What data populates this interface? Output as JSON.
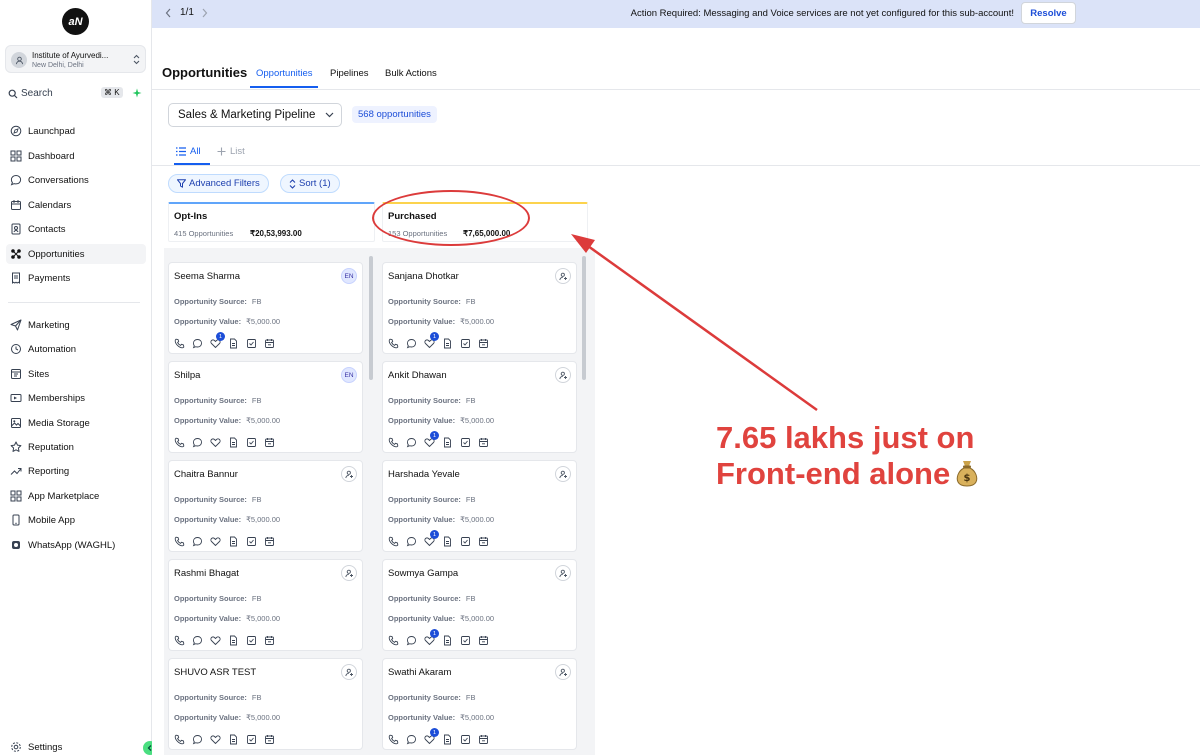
{
  "sidebar": {
    "logo": "aN",
    "account": {
      "name": "Institute of Ayurvedi...",
      "location": "New Delhi, Delhi"
    },
    "search": {
      "label": "Search",
      "shortcut": "⌘ K"
    },
    "items": [
      {
        "label": "Launchpad",
        "icon": "rocket-icon"
      },
      {
        "label": "Dashboard",
        "icon": "grid-icon"
      },
      {
        "label": "Conversations",
        "icon": "chat-icon"
      },
      {
        "label": "Calendars",
        "icon": "calendar-icon"
      },
      {
        "label": "Contacts",
        "icon": "contacts-icon"
      },
      {
        "label": "Opportunities",
        "icon": "opportunities-icon",
        "active": true
      },
      {
        "label": "Payments",
        "icon": "receipt-icon"
      },
      {
        "label": "Marketing",
        "icon": "send-icon"
      },
      {
        "label": "Automation",
        "icon": "automation-icon"
      },
      {
        "label": "Sites",
        "icon": "sites-icon"
      },
      {
        "label": "Memberships",
        "icon": "memberships-icon"
      },
      {
        "label": "Media Storage",
        "icon": "image-icon"
      },
      {
        "label": "Reputation",
        "icon": "star-icon"
      },
      {
        "label": "Reporting",
        "icon": "trend-icon"
      },
      {
        "label": "App Marketplace",
        "icon": "apps-icon"
      },
      {
        "label": "Mobile App",
        "icon": "phone-icon"
      },
      {
        "label": "WhatsApp (WAGHL)",
        "icon": "whatsapp-icon"
      }
    ],
    "settings": "Settings"
  },
  "banner": {
    "pager": "1/1",
    "message": "Action Required: Messaging and Voice services are not yet configured for this sub-account!",
    "resolve": "Resolve"
  },
  "header": {
    "title": "Opportunities",
    "tabs": [
      "Opportunities",
      "Pipelines",
      "Bulk Actions"
    ]
  },
  "toolbar": {
    "pipeline": "Sales & Marketing Pipeline",
    "count": "568 opportunities",
    "view_all": "All",
    "view_list": "List",
    "advanced_filters": "Advanced Filters",
    "sort": "Sort (1)"
  },
  "colors": {
    "accent": "#155eef",
    "banner": "#dbe3f8",
    "annotation": "#e0433e",
    "optins_bar": "#60a5fa",
    "purchased_bar": "#fcd34d"
  },
  "columns": [
    {
      "title": "Opt-Ins",
      "count": "415 Opportunities",
      "total": "₹20,53,993.00",
      "cards": [
        {
          "name": "Seema Sharma",
          "avatar": "EN",
          "source": "FB",
          "value": "₹5,000.00",
          "badge": "1"
        },
        {
          "name": "Shilpa",
          "avatar": "EN",
          "source": "FB",
          "value": "₹5,000.00",
          "badge": ""
        },
        {
          "name": "Chaitra Bannur",
          "avatar": "",
          "source": "FB",
          "value": "₹5,000.00",
          "badge": ""
        },
        {
          "name": "Rashmi Bhagat",
          "avatar": "",
          "source": "FB",
          "value": "₹5,000.00",
          "badge": ""
        },
        {
          "name": "SHUVO ASR TEST",
          "avatar": "",
          "source": "FB",
          "value": "₹5,000.00",
          "badge": ""
        }
      ]
    },
    {
      "title": "Purchased",
      "count": "153 Opportunities",
      "total": "₹7,65,000.00",
      "cards": [
        {
          "name": "Sanjana Dhotkar",
          "avatar": "",
          "source": "FB",
          "value": "₹5,000.00",
          "badge": "1"
        },
        {
          "name": "Ankit Dhawan",
          "avatar": "",
          "source": "FB",
          "value": "₹5,000.00",
          "badge": "1"
        },
        {
          "name": "Harshada Yevale",
          "avatar": "",
          "source": "FB",
          "value": "₹5,000.00",
          "badge": "1"
        },
        {
          "name": "Sowmya Gampa",
          "avatar": "",
          "source": "FB",
          "value": "₹5,000.00",
          "badge": "1"
        },
        {
          "name": "Swathi Akaram",
          "avatar": "",
          "source": "FB",
          "value": "₹5,000.00",
          "badge": "1"
        }
      ]
    }
  ],
  "card_labels": {
    "source": "Opportunity Source:",
    "value": "Opportunity Value:"
  },
  "annotation": {
    "line1": "7.65 lakhs just on",
    "line2": "Front-end alone"
  }
}
